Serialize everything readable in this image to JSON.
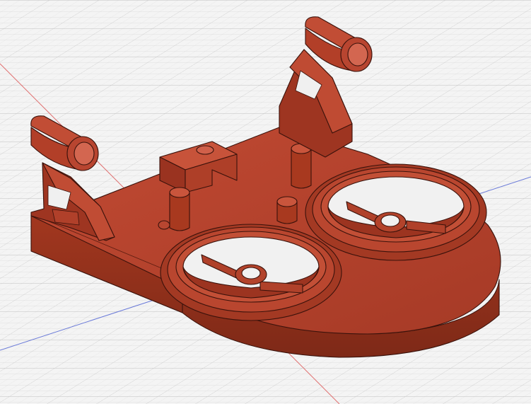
{
  "viewport": {
    "background": "#f4f4f4",
    "grid_color": "#c8c8c8",
    "axis_x_color": "#e07070",
    "axis_y_color": "#6a7ad8"
  },
  "model": {
    "body_color": "#b2402b",
    "shade_color": "#8e2f1f",
    "highlight_color": "#c9553c",
    "edge_color": "#3a120b",
    "parts": [
      "base-plate",
      "left-arm-mount",
      "right-arm-mount",
      "front-fan-duct",
      "rear-fan-duct",
      "bracket-block",
      "standoff-posts"
    ]
  }
}
